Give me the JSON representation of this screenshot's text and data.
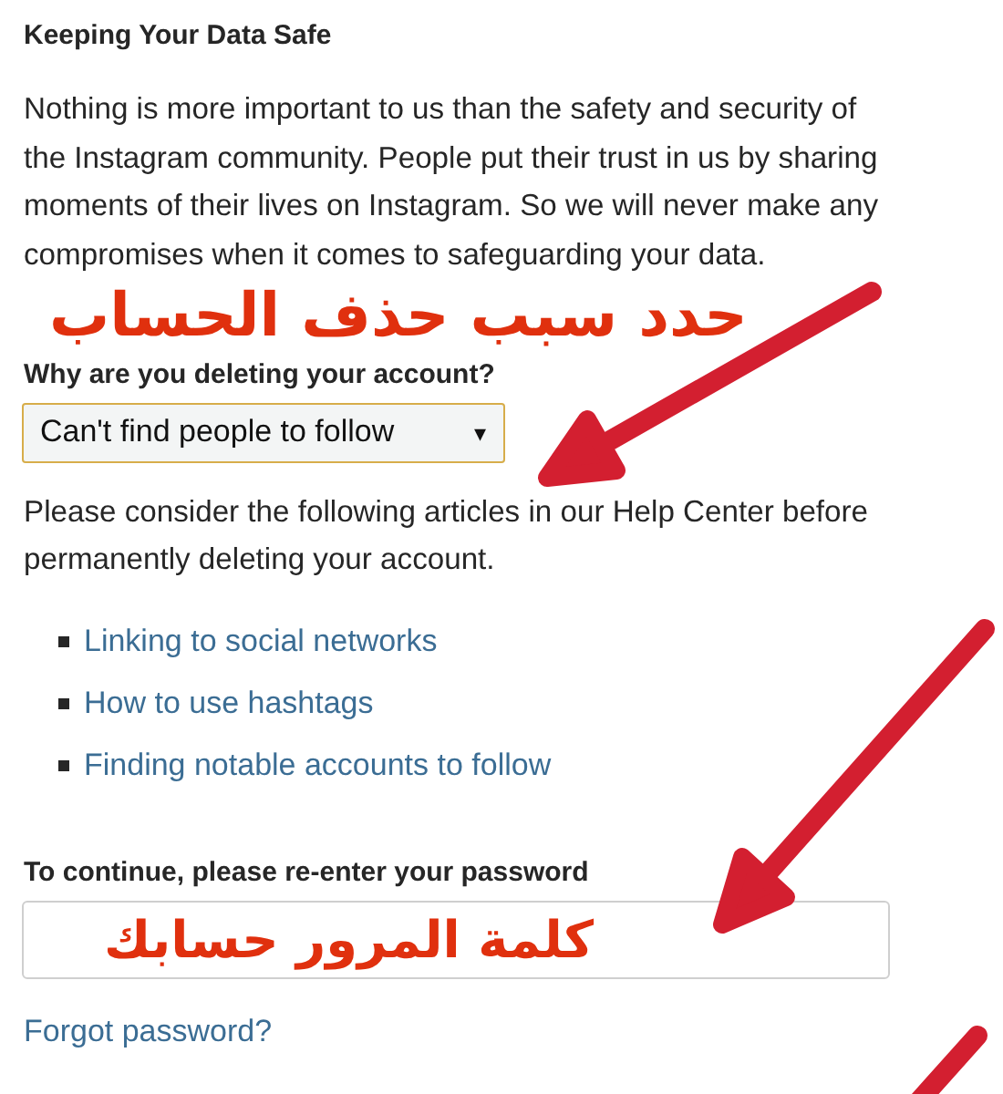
{
  "heading": "Keeping Your Data Safe",
  "intro_lines": [
    "Nothing is more important to us than the safety and security of",
    "the Instagram community. People put their trust in us by sharing",
    "moments of their lives on Instagram. So we will never make any",
    "compromises when it comes to safeguarding your data."
  ],
  "reason": {
    "label": "Why are you deleting your account?",
    "value": "Can't find people to follow",
    "caret": "▾"
  },
  "help_lines": [
    "Please consider the following articles in our Help Center before",
    "permanently deleting your account."
  ],
  "articles": [
    "Linking to social networks",
    "How to use hashtags",
    "Finding notable accounts to follow"
  ],
  "password": {
    "label": "To continue, please re-enter your password"
  },
  "forgot_link": "Forgot password?",
  "annotations": [
    {
      "text": "حدد سبب حذف الحساب"
    },
    {
      "text": "كلمة المرور حسابك"
    }
  ]
}
